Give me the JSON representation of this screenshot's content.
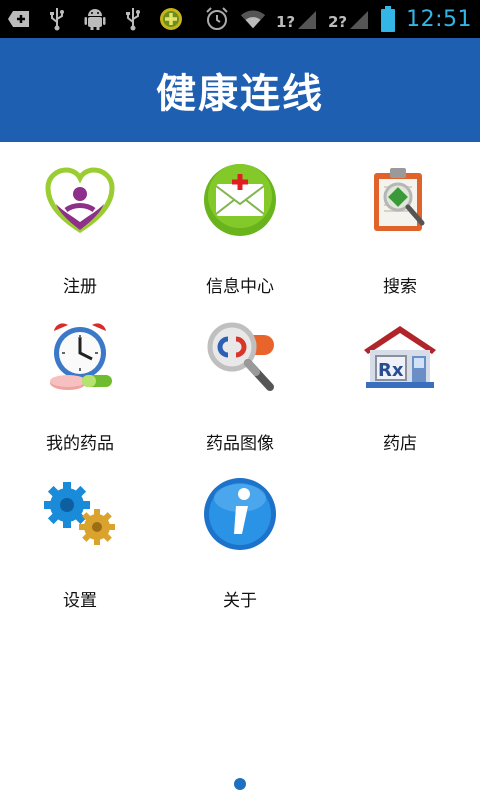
{
  "status_bar": {
    "time": "12:51",
    "left_icons": [
      "add-icon",
      "usb-icon",
      "android-icon",
      "usb-icon",
      "plus-circle-icon"
    ],
    "right_icons": [
      "alarm-icon",
      "wifi-icon",
      "sim1-signal-icon",
      "sim2-signal-icon",
      "battery-icon"
    ],
    "sim1_label": "1?",
    "sim2_label": "2?",
    "accent_color": "#33b5e5"
  },
  "header": {
    "title": "健康连线",
    "background_color": "#1f5fb1"
  },
  "menu": {
    "items": [
      {
        "label": "注册",
        "icon": "heart-person-icon"
      },
      {
        "label": "信息中心",
        "icon": "mail-icon"
      },
      {
        "label": "搜索",
        "icon": "clipboard-search-icon"
      },
      {
        "label": "我的药品",
        "icon": "alarm-clock-pills-icon"
      },
      {
        "label": "药品图像",
        "icon": "magnifier-pill-icon"
      },
      {
        "label": "药店",
        "icon": "pharmacy-icon"
      },
      {
        "label": "设置",
        "icon": "gears-icon"
      },
      {
        "label": "关于",
        "icon": "info-icon"
      }
    ]
  },
  "pager": {
    "current_page": 1,
    "total_pages": 1
  }
}
